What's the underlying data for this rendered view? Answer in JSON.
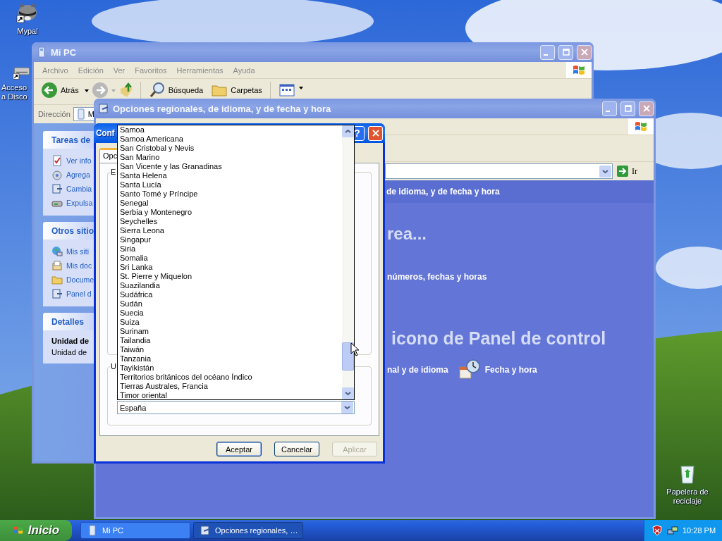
{
  "desktop_icons": [
    {
      "kind": "animal",
      "shortcut": true,
      "lines": [
        "Mypal"
      ]
    },
    {
      "kind": "drive",
      "shortcut": true,
      "lines": [
        "Acceso",
        "a Disco"
      ]
    },
    {
      "kind": "bin",
      "shortcut": false,
      "lines": [
        "Papelera de",
        "reciclaje"
      ]
    }
  ],
  "mi_pc_window": {
    "title": "Mi PC",
    "active": false,
    "menu": [
      "Archivo",
      "Edición",
      "Ver",
      "Favoritos",
      "Herramientas",
      "Ayuda"
    ],
    "toolbar": {
      "back": "Atrás",
      "search": "Búsqueda",
      "folders": "Carpetas"
    },
    "address_label": "Dirección",
    "address_value": "M",
    "panels": [
      {
        "title": "Tareas de",
        "items": [
          {
            "kind": "info",
            "label": "Ver info"
          },
          {
            "kind": "add",
            "label": "Agrega"
          },
          {
            "kind": "change",
            "label": "Cambia"
          },
          {
            "kind": "eject",
            "label": "Expulsa"
          }
        ]
      },
      {
        "title": "Otros sitio",
        "items": [
          {
            "kind": "network",
            "label": "Mis siti"
          },
          {
            "kind": "documents",
            "label": "Mis doc"
          },
          {
            "kind": "folder",
            "label": "Docume"
          },
          {
            "kind": "change",
            "label": "Panel d"
          }
        ]
      },
      {
        "title": "Detalles",
        "details": [
          {
            "text": "Unidad de",
            "bold": true
          },
          {
            "text": "Unidad de",
            "bold": false
          }
        ]
      }
    ]
  },
  "regional_window": {
    "title": "Opciones regionales, de idioma, y de fecha y hora",
    "active": false,
    "go_label": "Ir",
    "header": "de idioma, y de fecha y hora",
    "heading_1": "rea...",
    "task": "números, fechas y horas",
    "heading_2": "icono de Panel de control",
    "links": [
      {
        "kind": "none",
        "label": "nal y de idioma"
      },
      {
        "kind": "clock",
        "label": "Fecha y hora"
      }
    ]
  },
  "dialog": {
    "title": "Conf",
    "active": true,
    "help_glyph": "?",
    "tab": "Opc",
    "group_1": "E",
    "group_2": "U",
    "combo_value": "España",
    "list": [
      "Samoa",
      "Samoa Americana",
      "San Cristobal y Nevis",
      "San Marino",
      "San Vicente y las Granadinas",
      "Santa Helena",
      "Santa Lucía",
      "Santo Tomé y Príncipe",
      "Senegal",
      "Serbia y Montenegro",
      "Seychelles",
      "Sierra Leona",
      "Singapur",
      "Siria",
      "Somalia",
      "Sri Lanka",
      "St. Pierre y Miquelon",
      "Suazilandia",
      "Sudáfrica",
      "Sudán",
      "Suecia",
      "Suiza",
      "Surinam",
      "Tailandia",
      "Taiwán",
      "Tanzania",
      "Tayikistán",
      "Territorios británicos del océano Índico",
      "Tierras Australes, Francia",
      "Timor oriental"
    ],
    "buttons": [
      {
        "label": "Aceptar",
        "default": true,
        "disabled": false
      },
      {
        "label": "Cancelar",
        "default": false,
        "disabled": false
      },
      {
        "label": "Aplicar",
        "default": false,
        "disabled": true
      }
    ]
  },
  "taskbar": {
    "start": "Inicio",
    "tasks": [
      {
        "label": "Mi PC",
        "selected": false
      },
      {
        "label": "Opciones regionales, …",
        "selected": true
      }
    ],
    "clock": "10:28 PM"
  }
}
